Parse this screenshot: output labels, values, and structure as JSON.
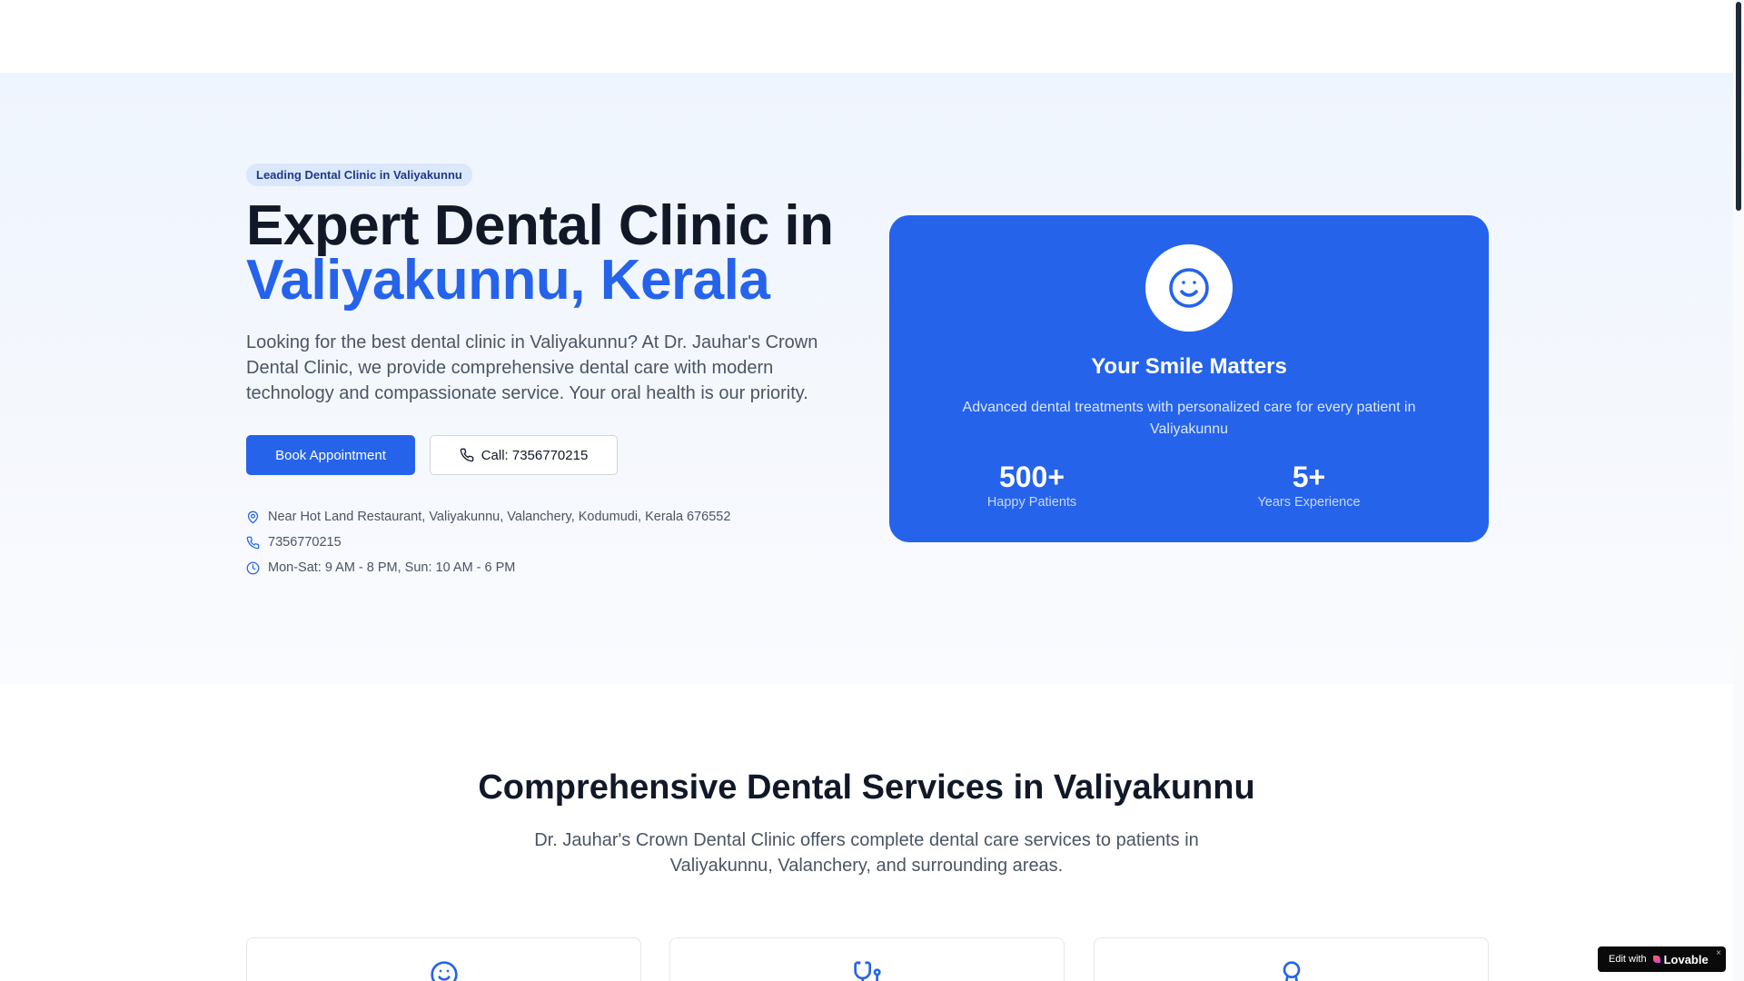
{
  "hero": {
    "badge": "Leading Dental Clinic in Valiyakunnu",
    "title_line1": "Expert Dental Clinic in",
    "title_line2": "Valiyakunnu, Kerala",
    "description": "Looking for the best dental clinic in Valiyakunnu? At Dr. Jauhar's Crown Dental Clinic, we provide comprehensive dental care with modern technology and compassionate service. Your oral health is our priority.",
    "book_button": "Book Appointment",
    "call_button": "Call: 7356770215",
    "address": "Near Hot Land Restaurant, Valiyakunnu, Valanchery, Kodumudi, Kerala 676552",
    "phone": "7356770215",
    "hours": "Mon-Sat: 9 AM - 8 PM, Sun: 10 AM - 6 PM"
  },
  "card": {
    "icon": "smile-icon",
    "title": "Your Smile Matters",
    "description": "Advanced dental treatments with personalized care for every patient in Valiyakunnu",
    "stats": [
      {
        "value": "500+",
        "label": "Happy Patients"
      },
      {
        "value": "5+",
        "label": "Years Experience"
      }
    ]
  },
  "services": {
    "title": "Comprehensive Dental Services in Valiyakunnu",
    "description": "Dr. Jauhar's Crown Dental Clinic offers complete dental care services to patients in Valiyakunnu, Valanchery, and surrounding areas.",
    "card_icons": [
      "smile-icon",
      "stethoscope-icon",
      "award-icon"
    ]
  },
  "lovable": {
    "prefix": "Edit with",
    "brand": "Lovable",
    "close": "×"
  },
  "colors": {
    "accent": "#2563eb",
    "text": "#111827",
    "muted": "#4b5563"
  }
}
